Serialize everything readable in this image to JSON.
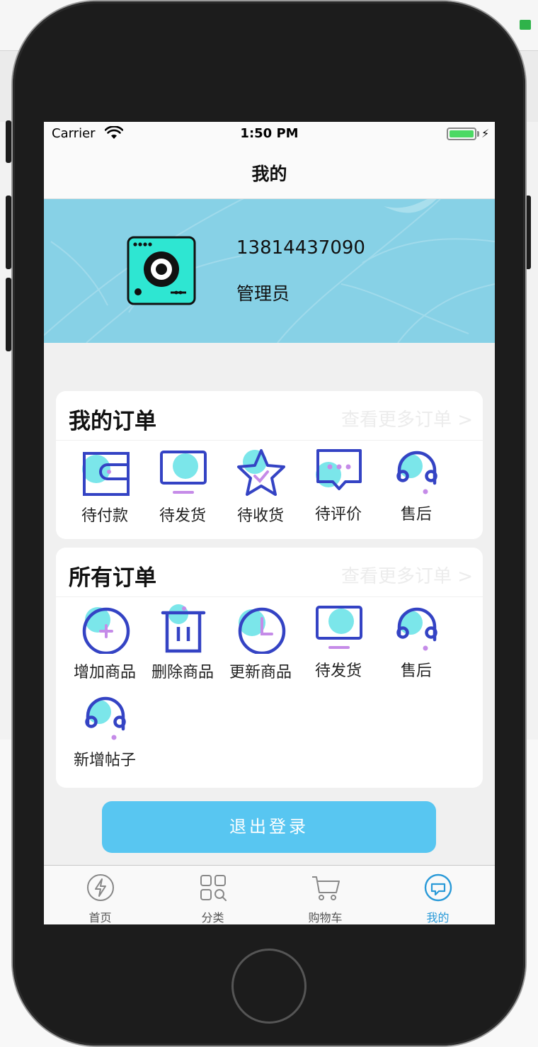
{
  "status_bar": {
    "carrier": "Carrier",
    "time": "1:50 PM"
  },
  "nav": {
    "title": "我的"
  },
  "profile": {
    "phone": "13814437090",
    "role": "管理员"
  },
  "orders_card": {
    "title": "我的订单",
    "more": "查看更多订单 >",
    "items": [
      {
        "label": "待付款",
        "icon": "wallet-icon"
      },
      {
        "label": "待发货",
        "icon": "monitor-icon"
      },
      {
        "label": "待收货",
        "icon": "star-icon"
      },
      {
        "label": "待评价",
        "icon": "chat-bubble-icon"
      },
      {
        "label": "售后",
        "icon": "headset-icon"
      }
    ]
  },
  "all_orders_card": {
    "title": "所有订单",
    "more": "查看更多订单 >",
    "items": [
      {
        "label": "增加商品",
        "icon": "plus-circle-icon"
      },
      {
        "label": "删除商品",
        "icon": "trash-icon"
      },
      {
        "label": "更新商品",
        "icon": "clock-icon"
      },
      {
        "label": "待发货",
        "icon": "monitor-icon"
      },
      {
        "label": "售后",
        "icon": "headset-icon"
      },
      {
        "label": "新增帖子",
        "icon": "headset-icon"
      }
    ]
  },
  "logout": {
    "label": "退出登录"
  },
  "tab_bar": {
    "items": [
      {
        "label": "首页",
        "icon": "lightning-icon",
        "active": false
      },
      {
        "label": "分类",
        "icon": "category-grid-icon",
        "active": false
      },
      {
        "label": "购物车",
        "icon": "cart-icon",
        "active": false
      },
      {
        "label": "我的",
        "icon": "profile-chat-icon",
        "active": true
      }
    ]
  },
  "colors": {
    "banner": "#87d1e6",
    "icon_stroke": "#3443c4",
    "icon_accent": "#7be6ea",
    "icon_purple": "#c58be8",
    "logout_button": "#58c6f1",
    "tab_active": "#2a9ad8"
  }
}
